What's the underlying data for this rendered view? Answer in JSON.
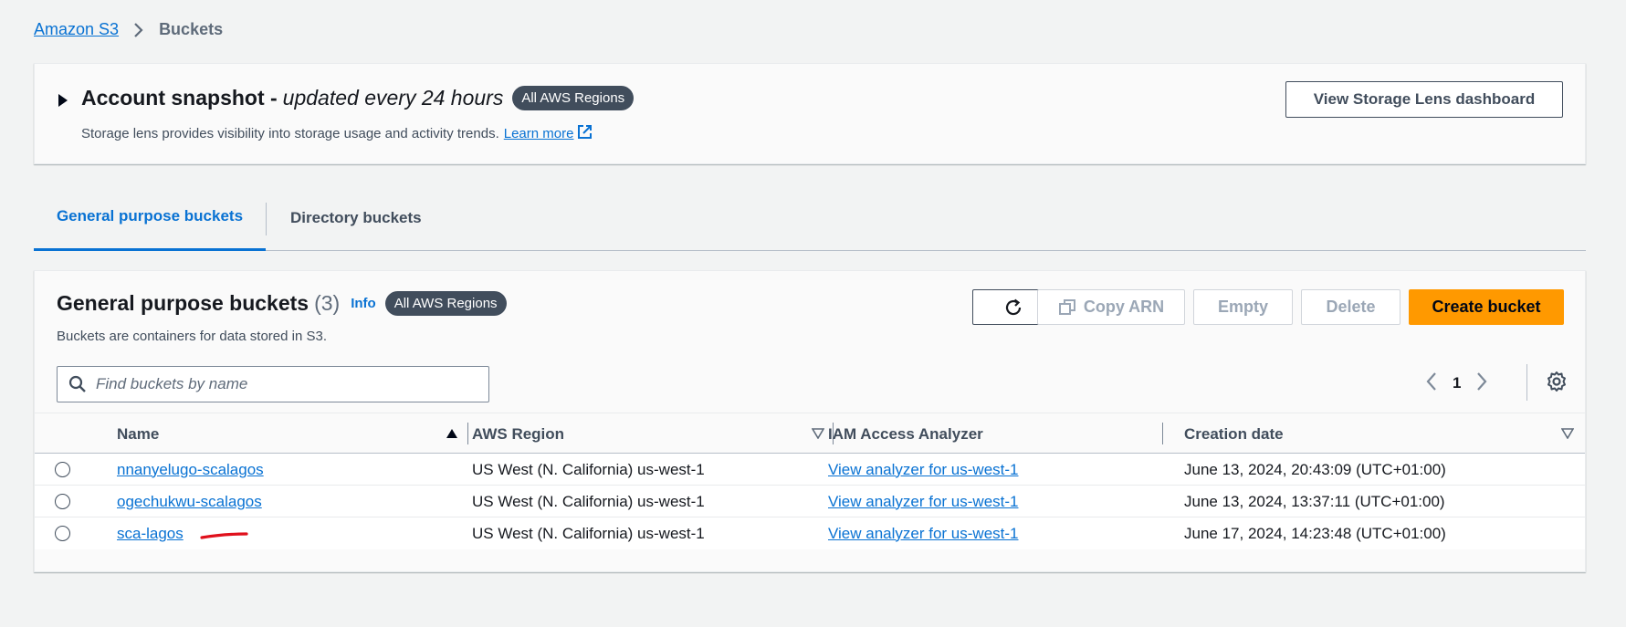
{
  "breadcrumb": {
    "root": "Amazon S3",
    "current": "Buckets"
  },
  "snapshot": {
    "title_bold": "Account snapshot -",
    "title_italic": "updated every 24 hours",
    "badge": "All AWS Regions",
    "description": "Storage lens provides visibility into storage usage and activity trends.",
    "learn_more": "Learn more",
    "lens_button": "View Storage Lens dashboard"
  },
  "tabs": {
    "general": "General purpose buckets",
    "directory": "Directory buckets"
  },
  "buckets_panel": {
    "title": "General purpose buckets",
    "count": "(3)",
    "info": "Info",
    "badge": "All AWS Regions",
    "description": "Buckets are containers for data stored in S3.",
    "copy_arn": "Copy ARN",
    "empty": "Empty",
    "delete": "Delete",
    "create": "Create bucket",
    "search_placeholder": "Find buckets by name",
    "page": "1"
  },
  "table": {
    "columns": {
      "name": "Name",
      "region": "AWS Region",
      "iam": "IAM Access Analyzer",
      "date": "Creation date"
    },
    "rows": [
      {
        "name": "nnanyelugo-scalagos",
        "region": "US West (N. California) us-west-1",
        "iam": "View analyzer for us-west-1",
        "date": "June 13, 2024, 20:43:09 (UTC+01:00)"
      },
      {
        "name": "ogechukwu-scalagos",
        "region": "US West (N. California) us-west-1",
        "iam": "View analyzer for us-west-1",
        "date": "June 13, 2024, 13:37:11 (UTC+01:00)"
      },
      {
        "name": "sca-lagos",
        "region": "US West (N. California) us-west-1",
        "iam": "View analyzer for us-west-1",
        "date": "June 17, 2024, 14:23:48 (UTC+01:00)"
      }
    ]
  },
  "colors": {
    "link": "#0972d3",
    "primary_button": "#ff9900",
    "badge_bg": "#414d5c",
    "annotation_mark": "#e0101c"
  }
}
